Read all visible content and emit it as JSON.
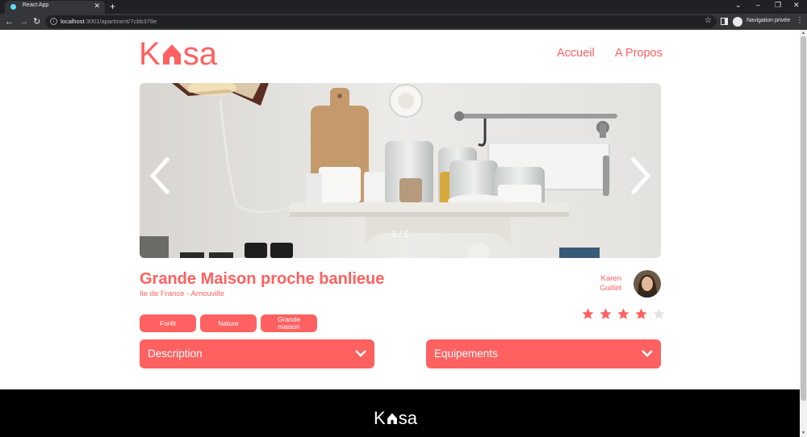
{
  "browser": {
    "tab_title": "React App",
    "tab_close": "✕",
    "new_tab": "+",
    "url_host": "localhost",
    "url_path": ":3001/apartment/7cbb378e",
    "private_label": "Navigation privée"
  },
  "header": {
    "logo_left": "K",
    "logo_right": "sa",
    "nav": [
      "Accueil",
      "A Propos"
    ]
  },
  "gallery": {
    "current": 3,
    "total": 5,
    "counter": "3 / 5"
  },
  "listing": {
    "title": "Grande Maison proche banlieue",
    "location": "Ile de France - Arnouville",
    "tags": [
      "Forêt",
      "Nature",
      "Grande maison"
    ],
    "host_first": "Karen",
    "host_last": "Guillet",
    "rating": 4,
    "rating_max": 5
  },
  "sections": {
    "description_label": "Description",
    "equipments_label": "Equipements"
  },
  "colors": {
    "brand": "#ff6060",
    "star_off": "#e3e3e3",
    "footer_bg": "#000000"
  },
  "icons": {
    "prev": "chevron-left-icon",
    "next": "chevron-right-icon",
    "collapse": "chevron-down-icon",
    "star": "star-icon"
  }
}
